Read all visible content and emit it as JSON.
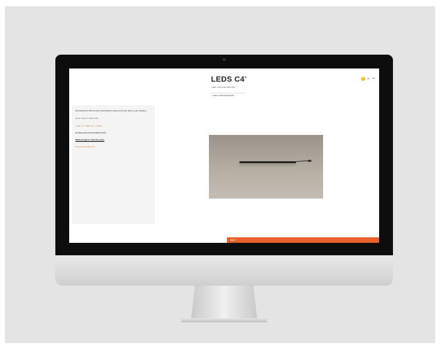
{
  "brand": {
    "logo_text": "LEDS C4",
    "logo_mark": "+",
    "tagline": "LED CONFIGURATOR"
  },
  "header": {
    "lang_label": "EN"
  },
  "tab": {
    "label": "LINE CONFIGURATOR"
  },
  "sidebar": {
    "title": "Download the PDF product specification sheet and more files to your desktop",
    "subtitle": "Model: LINE 1.5 1800 2700K",
    "orange_link": "LINE 1.5 • 1800 mm • 2700K",
    "doc_label": "DOWNLOAD DOCUMENTATION",
    "login_link": "Please login to view the price",
    "orange_link_2": "Find a local sales rep"
  },
  "footer_bar": {
    "label": "NEXT"
  },
  "colors": {
    "accent_orange": "#e8602b",
    "link_orange": "#e0782e",
    "cart_yellow": "#f2c230"
  },
  "icons": {
    "cart": "cart-icon",
    "menu": "menu-icon",
    "camera": "camera-icon"
  }
}
